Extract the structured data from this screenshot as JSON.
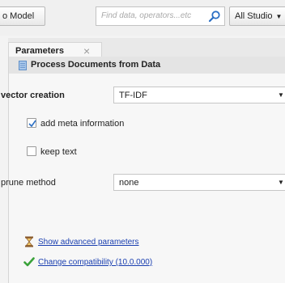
{
  "toolbar": {
    "model_button": "o Model",
    "search_placeholder": "Find data, operators...etc",
    "studio_button": "All Studio"
  },
  "tabs": [
    {
      "label": "Parameters"
    }
  ],
  "operator": {
    "name": "Process Documents from Data"
  },
  "parameters": {
    "vector_creation": {
      "label": "vector creation",
      "value": "TF-IDF"
    },
    "add_meta_information": {
      "label": "add meta information",
      "checked": true
    },
    "keep_text": {
      "label": "keep text",
      "checked": false
    },
    "prune_method": {
      "label": "prune method",
      "value": "none"
    }
  },
  "links": {
    "advanced": "Show advanced parameters",
    "compatibility": "Change compatibility (10.0.000)"
  },
  "colors": {
    "link": "#1a3fb0",
    "check_green": "#3aa23a",
    "accent_blue": "#2b6fc4"
  }
}
